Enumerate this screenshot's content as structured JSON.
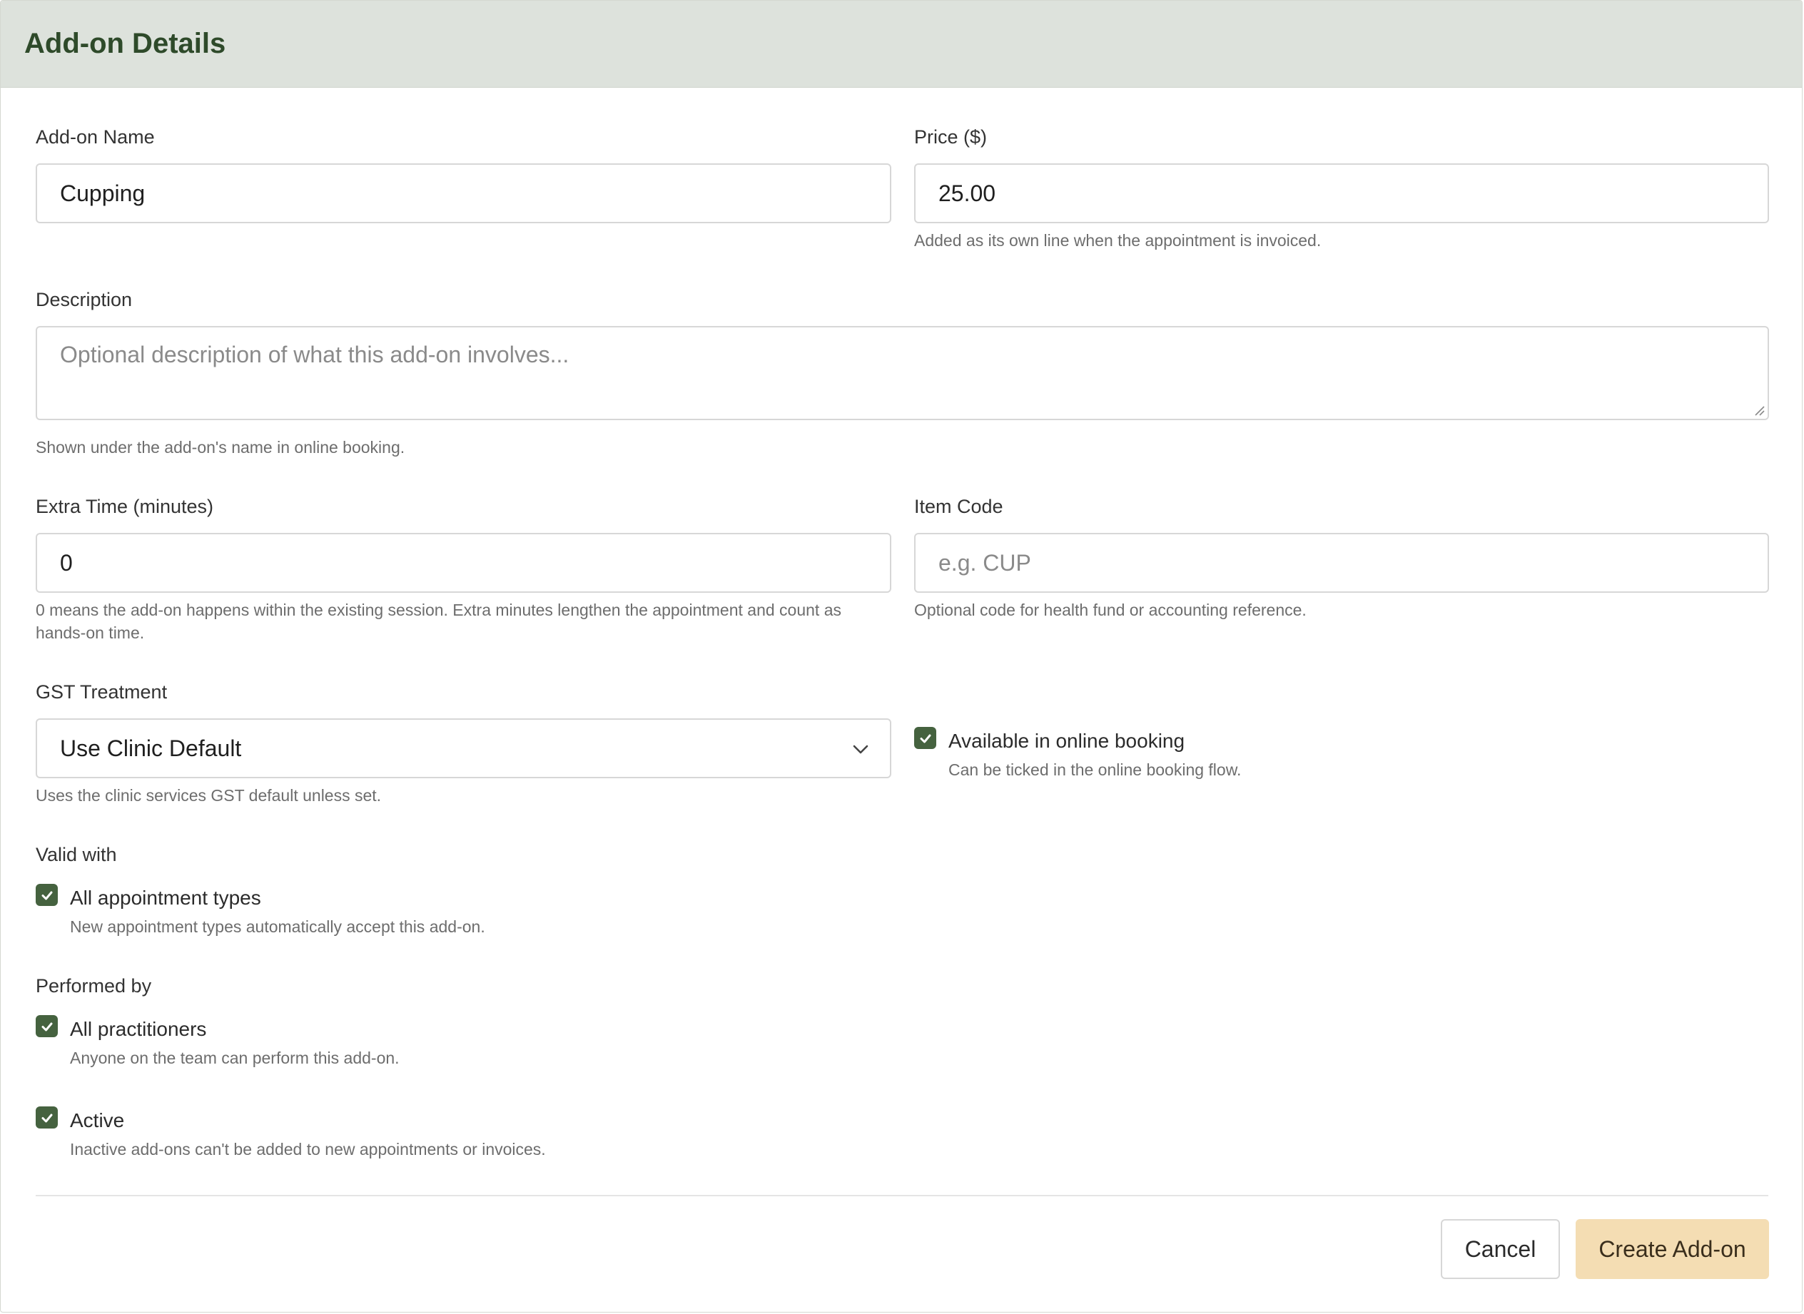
{
  "header": {
    "title": "Add-on Details"
  },
  "fields": {
    "name": {
      "label": "Add-on Name",
      "value": "Cupping"
    },
    "price": {
      "label": "Price ($)",
      "value": "25.00",
      "hint": "Added as its own line when the appointment is invoiced."
    },
    "description": {
      "label": "Description",
      "placeholder": "Optional description of what this add-on involves...",
      "hint": "Shown under the add-on's name in online booking."
    },
    "extra_time": {
      "label": "Extra Time (minutes)",
      "value": "0",
      "hint_line1": "0 means the add-on happens within the existing session. Extra minutes lengthen the appointment and count as",
      "hint_line2": "hands-on time."
    },
    "item_code": {
      "label": "Item Code",
      "placeholder": "e.g. CUP",
      "hint": "Optional code for health fund or accounting reference."
    },
    "gst": {
      "label": "GST Treatment",
      "value": "Use Clinic Default",
      "hint": "Uses the clinic services GST default unless set."
    }
  },
  "online_booking": {
    "label": "Available in online booking",
    "hint": "Can be ticked in the online booking flow.",
    "checked": true
  },
  "valid_with": {
    "title": "Valid with",
    "label": "All appointment types",
    "hint": "New appointment types automatically accept this add-on.",
    "checked": true
  },
  "performed_by": {
    "title": "Performed by",
    "label": "All practitioners",
    "hint": "Anyone on the team can perform this add-on.",
    "checked": true
  },
  "active": {
    "label": "Active",
    "hint": "Inactive add-ons can't be added to new appointments or invoices.",
    "checked": true
  },
  "actions": {
    "cancel": "Cancel",
    "create": "Create Add-on"
  },
  "colors": {
    "header_bg": "#dde2dc",
    "title": "#2e4a2a",
    "checkbox": "#45623f",
    "primary_button": "#f4ddb3"
  },
  "icons": {
    "checkbox": "check-icon",
    "select": "chevron-down-icon",
    "textarea": "resize-handle-icon"
  }
}
